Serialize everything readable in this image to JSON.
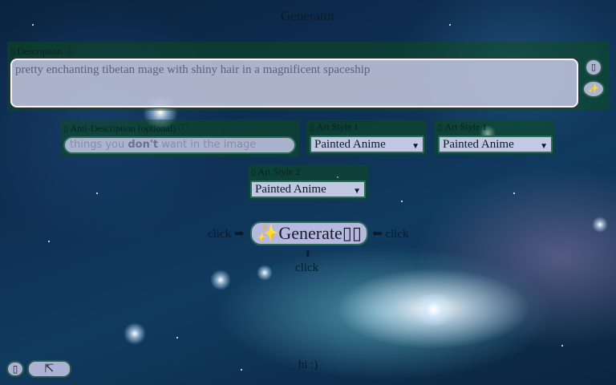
{
  "app": {
    "title": "Generator"
  },
  "description": {
    "label": "Description",
    "info_glyph": "ⓘ",
    "value": "pretty enchanting tibetan mage with shiny hair in a magnificent spaceship",
    "side_buttons": [
      {
        "icon": "clipboard-icon",
        "glyph": "▯"
      },
      {
        "icon": "sparkle-icon",
        "glyph": "✨"
      }
    ]
  },
  "anti_description": {
    "label": "Anti-Description (optional)",
    "info_glyph": "ⓘ",
    "placeholder_pre": "things you ",
    "placeholder_bold": "don't",
    "placeholder_post": " want in the image"
  },
  "art_styles": [
    {
      "label": "Art Style 1",
      "selected": "Painted Anime"
    },
    {
      "label": "Art Style 1",
      "selected": "Painted Anime"
    },
    {
      "label": "Art Style 2",
      "selected": "Painted Anime"
    }
  ],
  "generate": {
    "label": "✨Generate▯▯",
    "click_left": "click ➡",
    "click_right": "⬅ click",
    "click_below_arrow": "⬆",
    "click_below": "click"
  },
  "footer": {
    "left_button_glyph": "▯",
    "expand_button_glyph": "⇱",
    "greeting": "hi :)"
  }
}
